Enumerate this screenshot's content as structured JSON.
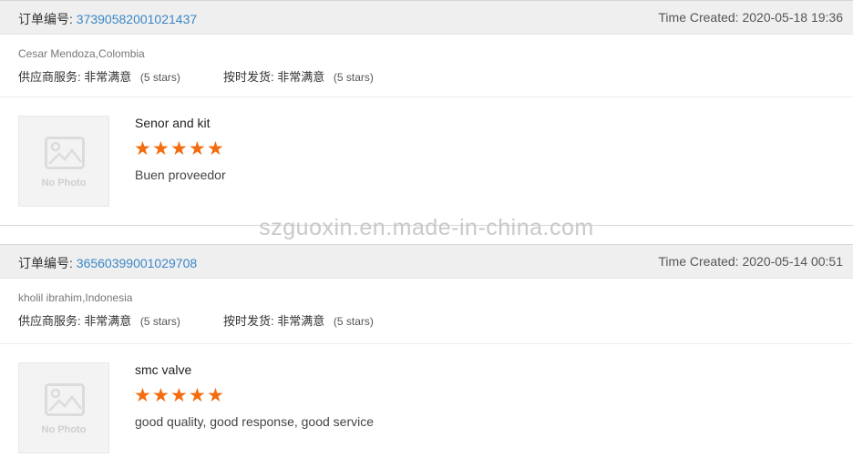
{
  "watermark": "szguoxin.en.made-in-china.com",
  "orders": [
    {
      "order_label": "订单编号:",
      "order_number": "37390582001021437",
      "time_created": "Time Created: 2020-05-18 19:36",
      "buyer": "Cesar Mendoza,Colombia",
      "supplier_service_label": "供应商服务:",
      "supplier_service_value": "非常满意",
      "supplier_service_stars": "(5 stars)",
      "ontime_label": "按时发货:",
      "ontime_value": "非常满意",
      "ontime_stars": "(5 stars)",
      "photo_placeholder": "No Photo",
      "product_name": "Senor and kit",
      "rating": 5,
      "comment": "Buen proveedor"
    },
    {
      "order_label": "订单编号:",
      "order_number": "36560399001029708",
      "time_created": "Time Created: 2020-05-14 00:51",
      "buyer": "kholil ibrahim,Indonesia",
      "supplier_service_label": "供应商服务:",
      "supplier_service_value": "非常满意",
      "supplier_service_stars": "(5 stars)",
      "ontime_label": "按时发货:",
      "ontime_value": "非常满意",
      "ontime_stars": "(5 stars)",
      "photo_placeholder": "No Photo",
      "product_name": "smc valve",
      "rating": 5,
      "comment": "good quality, good response, good service"
    }
  ],
  "colors": {
    "star": "#f36d10",
    "order_number": "#3a87c8",
    "header_bg": "#efefef"
  },
  "icons": {
    "star": "star-icon",
    "photo": "image-placeholder-icon"
  }
}
